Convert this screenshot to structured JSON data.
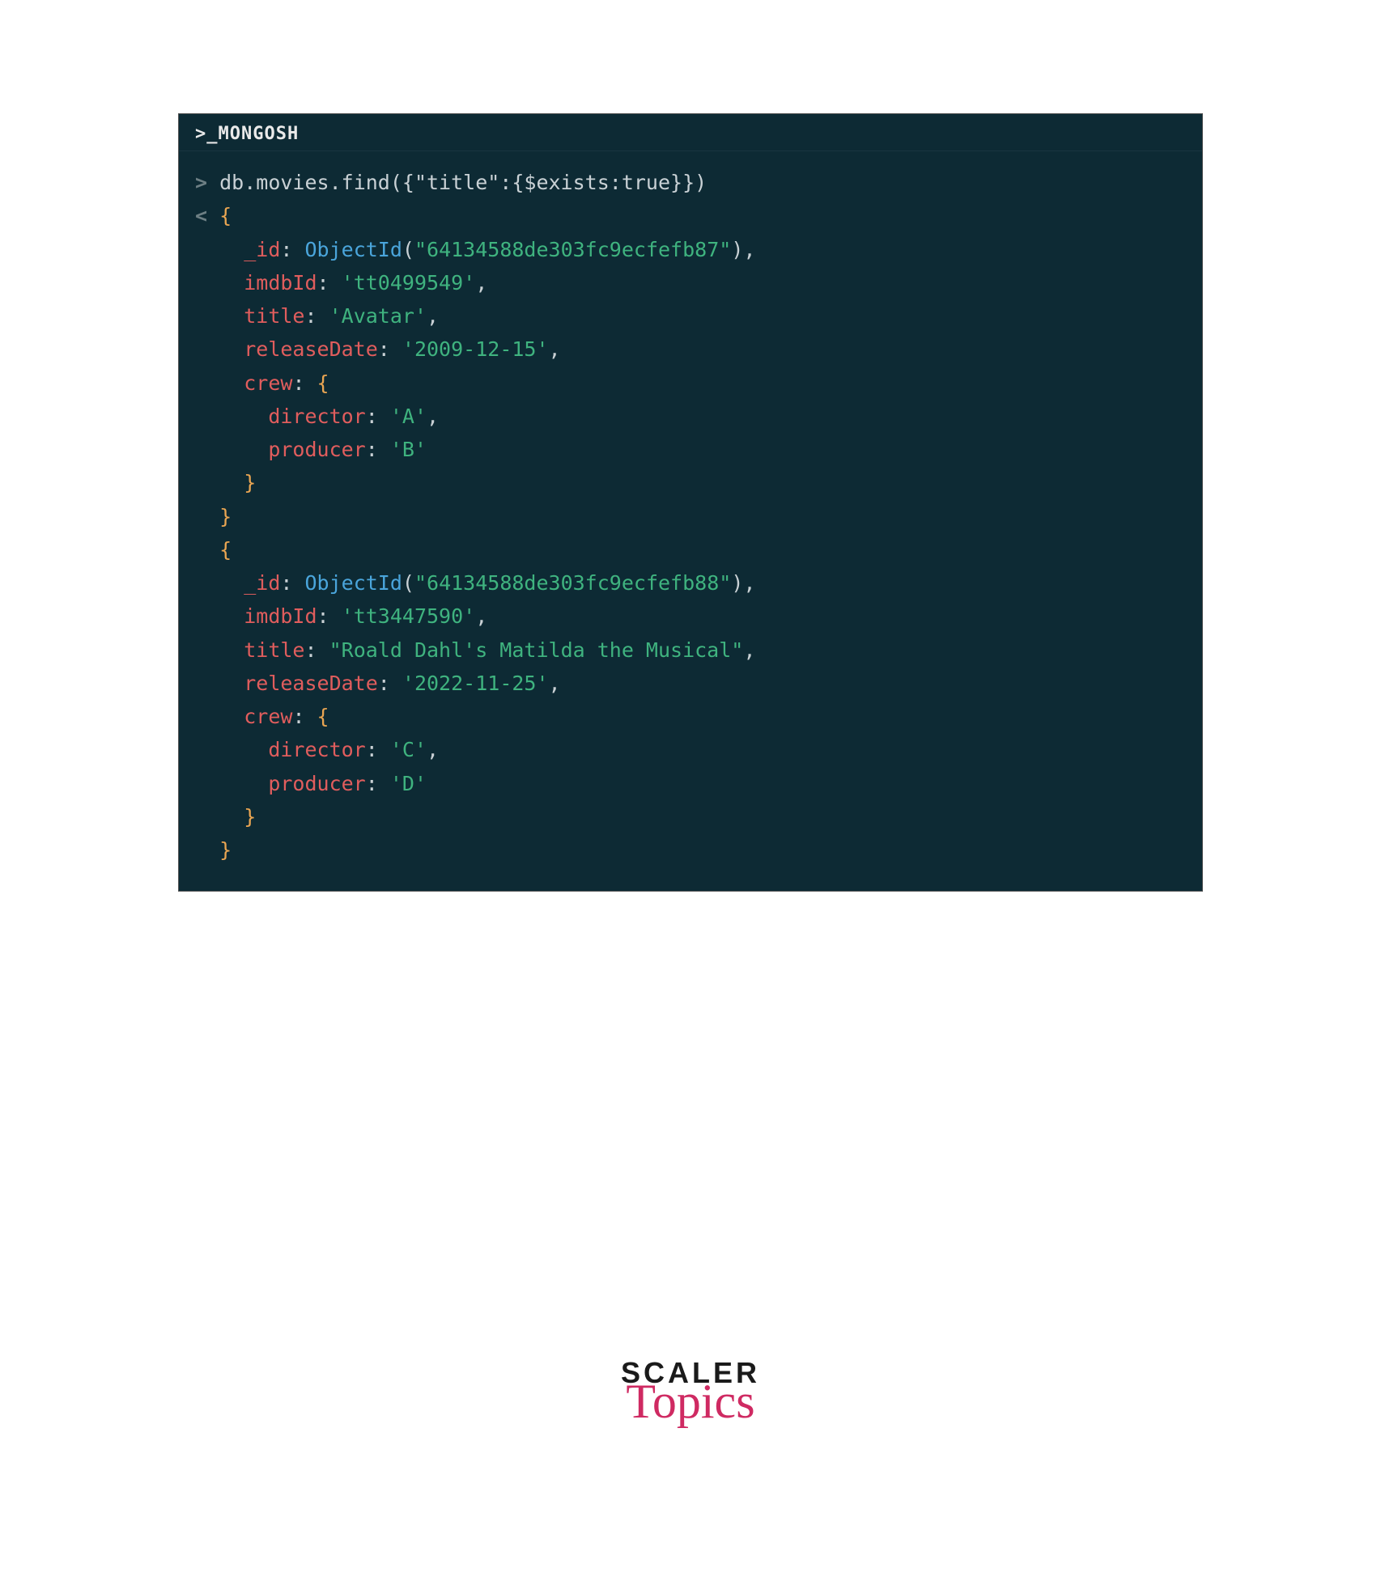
{
  "title_bar": ">_MONGOSH",
  "prompt_in": ">",
  "prompt_out": "<",
  "command": "db.movies.find({\"title\":{$exists:true}})",
  "doc1": {
    "id_key": "_id",
    "objectid_fn": "ObjectId",
    "objectid_val": "\"64134588de303fc9ecfefb87\"",
    "imdb_key": "imdbId",
    "imdb_val": "'tt0499549'",
    "title_key": "title",
    "title_val": "'Avatar'",
    "date_key": "releaseDate",
    "date_val": "'2009-12-15'",
    "crew_key": "crew",
    "director_key": "director",
    "director_val": "'A'",
    "producer_key": "producer",
    "producer_val": "'B'"
  },
  "doc2": {
    "id_key": "_id",
    "objectid_fn": "ObjectId",
    "objectid_val": "\"64134588de303fc9ecfefb88\"",
    "imdb_key": "imdbId",
    "imdb_val": "'tt3447590'",
    "title_key": "title",
    "title_val": "\"Roald Dahl's Matilda the Musical\"",
    "date_key": "releaseDate",
    "date_val": "'2022-11-25'",
    "crew_key": "crew",
    "director_key": "director",
    "director_val": "'C'",
    "producer_key": "producer",
    "producer_val": "'D'"
  },
  "brand": {
    "top": "SCALER",
    "bottom": "Topics"
  }
}
